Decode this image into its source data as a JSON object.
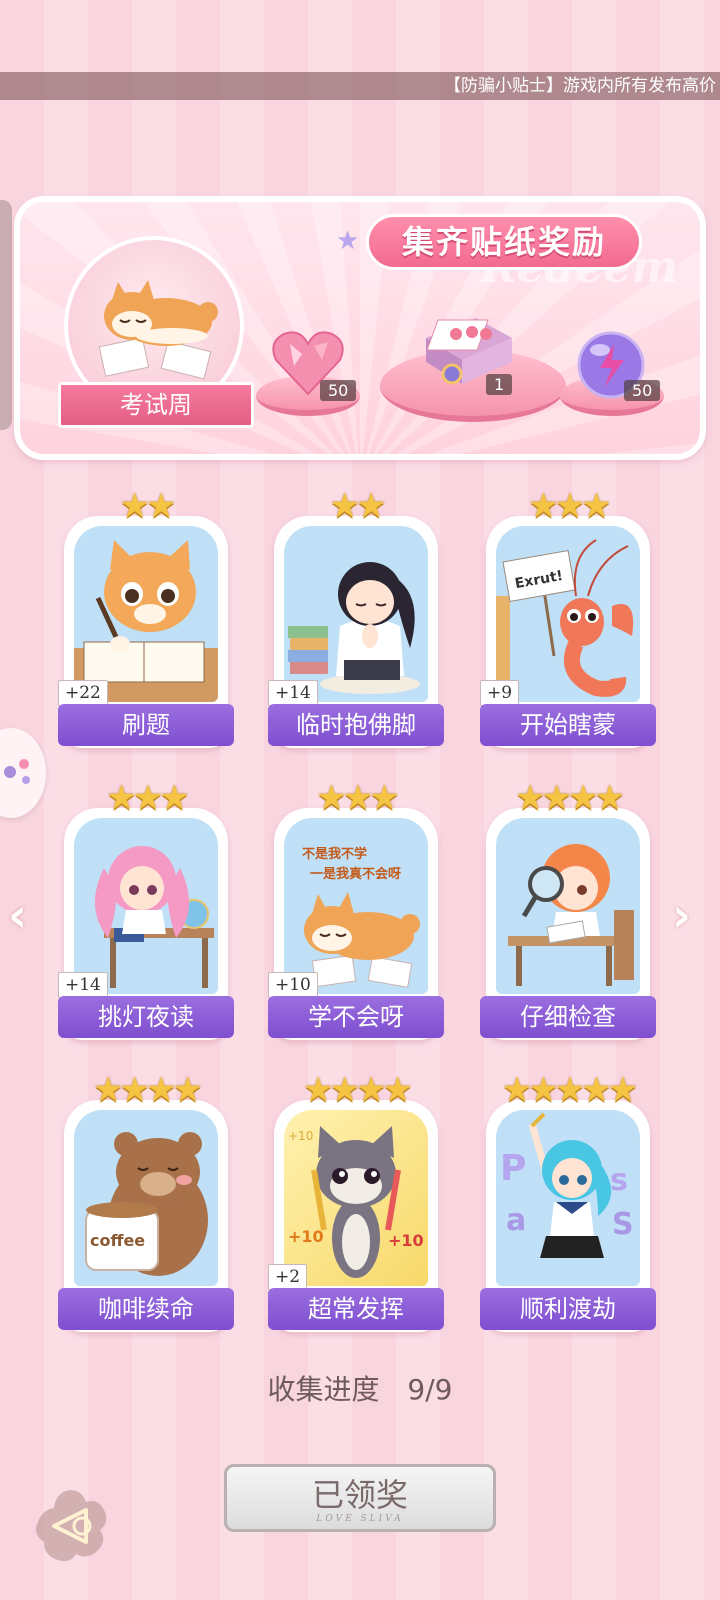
{
  "ticker": {
    "text": "【防骗小贴士】游戏内所有发布高价"
  },
  "banner": {
    "title": "集齐贴纸奖励",
    "watermark": "Redeem",
    "theme_label": "考试周",
    "rewards": [
      {
        "name": "heart-gem",
        "count": "50"
      },
      {
        "name": "gift-box",
        "count": "1"
      },
      {
        "name": "energy-orb",
        "count": "50"
      }
    ]
  },
  "cards": [
    {
      "title": "刷题",
      "bonus": "+22",
      "stars": 2,
      "art": "orange-cat-writing"
    },
    {
      "title": "临时抱佛脚",
      "bonus": "+14",
      "stars": 2,
      "art": "girl-praying-books"
    },
    {
      "title": "开始瞎蒙",
      "bonus": "+9",
      "stars": 3,
      "art": "shrimp-sign",
      "sign_text": "Exrut!"
    },
    {
      "title": "挑灯夜读",
      "bonus": "+14",
      "stars": 3,
      "art": "pink-girl-desk"
    },
    {
      "title": "学不会呀",
      "bonus": "+10",
      "stars": 3,
      "art": "shiba-lying",
      "art_text": [
        "不是我不学",
        "一是我真不会呀"
      ]
    },
    {
      "title": "仔细检查",
      "bonus": "",
      "stars": 4,
      "art": "girl-magnifier"
    },
    {
      "title": "咖啡续命",
      "bonus": "",
      "stars": 4,
      "art": "bear-coffee",
      "art_text": [
        "coffee"
      ]
    },
    {
      "title": "超常发挥",
      "bonus": "+2",
      "stars": 4,
      "art": "cat-pencils",
      "art_text": [
        "+10",
        "+10",
        "+10"
      ]
    },
    {
      "title": "顺利渡劫",
      "bonus": "",
      "stars": 5,
      "art": "blue-girl-letters"
    }
  ],
  "progress": {
    "label": "收集进度",
    "value": "9/9"
  },
  "claim_button": {
    "label": "已领奖",
    "sub": "LOVE SLIVA"
  },
  "colors": {
    "card_label": "#8b5cd6",
    "banner_title": "#f26a90",
    "star": "#f6c443"
  }
}
